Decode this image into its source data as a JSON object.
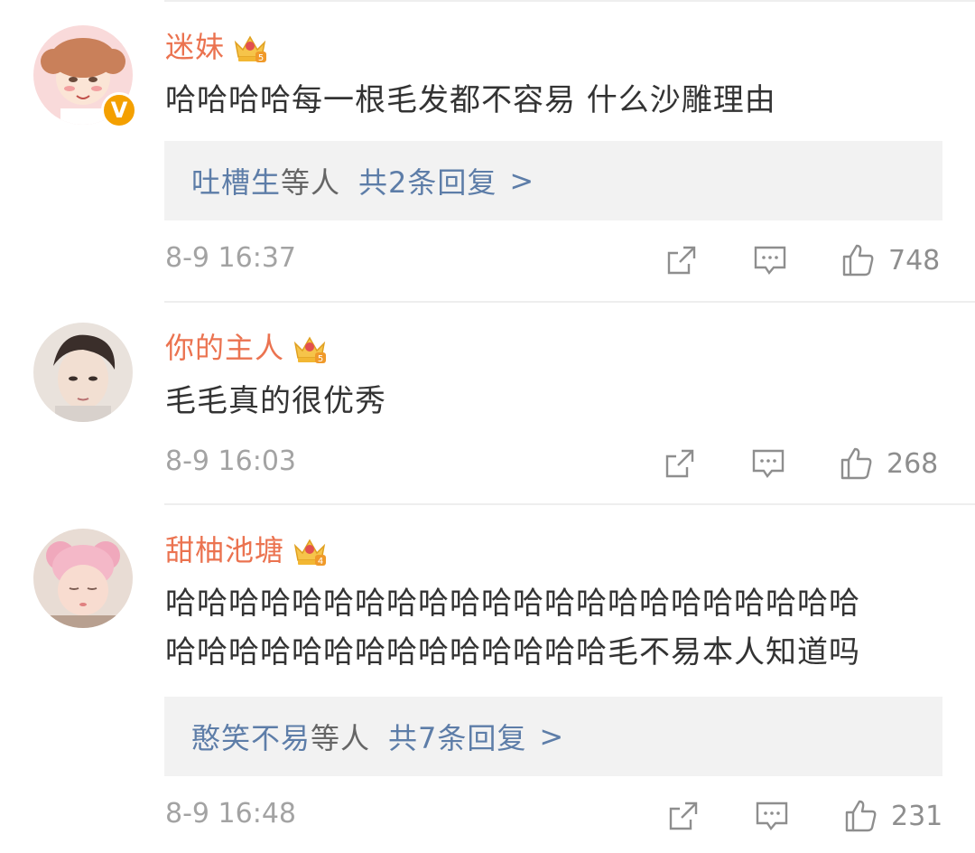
{
  "comments": [
    {
      "username": "迷妹",
      "text": "哈哈哈哈每一根毛发都不容易 什么沙雕理由",
      "verified_badge": "V",
      "reply_names": "吐槽生",
      "reply_suffix": "等人",
      "reply_count": "共2条回复",
      "reply_arrow": ">",
      "time": "8-9 16:37",
      "likes": "748",
      "avatar_bg": "#f9d6d6"
    },
    {
      "username": "你的主人",
      "text": "毛毛真的很优秀",
      "time": "8-9 16:03",
      "likes": "268",
      "avatar_bg": "#e9e2dc"
    },
    {
      "username": "甜柚池塘",
      "text_line1": "哈哈哈哈哈哈哈哈哈哈哈哈哈哈哈哈哈哈哈哈哈哈",
      "text_line2": "哈哈哈哈哈哈哈哈哈哈哈哈哈哈毛不易本人知道吗",
      "reply_names": "憨笑不易",
      "reply_suffix": "等人",
      "reply_count": "共7条回复",
      "reply_arrow": ">",
      "time": "8-9 16:48",
      "likes": "231",
      "avatar_bg": "#f4c6d2"
    }
  ],
  "icons": {
    "share": "share-icon",
    "comment": "comment-icon",
    "like": "thumbs-up-icon",
    "crown": "crown-badge-icon"
  },
  "colors": {
    "username": "#eb7350",
    "link": "#5d7da8",
    "text": "#333333",
    "meta": "#a3a3a3",
    "reply_bg": "#f2f2f2"
  }
}
